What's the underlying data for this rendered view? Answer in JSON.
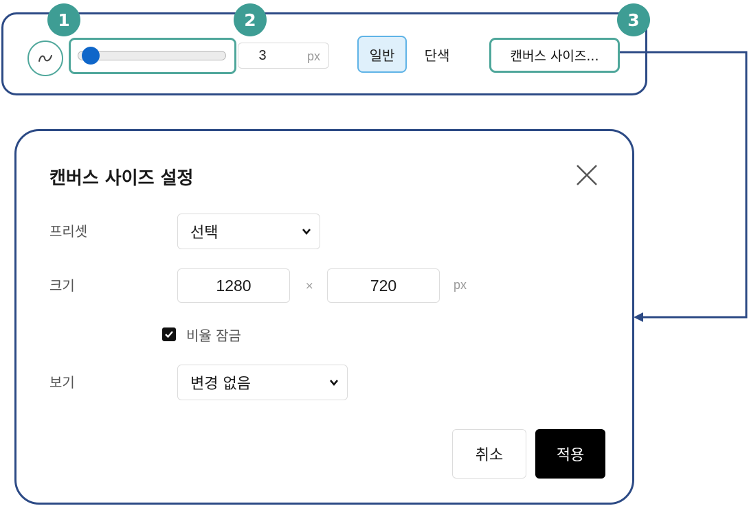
{
  "badges": [
    "1",
    "2",
    "3"
  ],
  "toolbar": {
    "stroke_icon": "stroke-wave-icon",
    "brush_size": {
      "value": "3",
      "unit": "px",
      "slider_level": 0.03
    },
    "modes": {
      "normal": "일반",
      "mono": "단색",
      "active": "normal"
    },
    "canvas_size_button": "캔버스 사이즈..."
  },
  "dialog": {
    "title": "캔버스 사이즈 설정",
    "close_icon": "close-icon",
    "preset": {
      "label": "프리셋",
      "selected": "선택"
    },
    "size": {
      "label": "크기",
      "width": "1280",
      "separator": "×",
      "height": "720",
      "unit": "px"
    },
    "lock_ratio": {
      "label": "비율 잠금",
      "checked": true
    },
    "view": {
      "label": "보기",
      "selected": "변경 없음"
    },
    "buttons": {
      "cancel": "취소",
      "apply": "적용"
    }
  },
  "colors": {
    "panel_border": "#2c4a85",
    "badge": "#3e9d94",
    "highlight": "#4fa79b",
    "slider_thumb": "#0f66c9",
    "active_mode_bg": "#dff0fb",
    "apply_button": "#000000"
  }
}
